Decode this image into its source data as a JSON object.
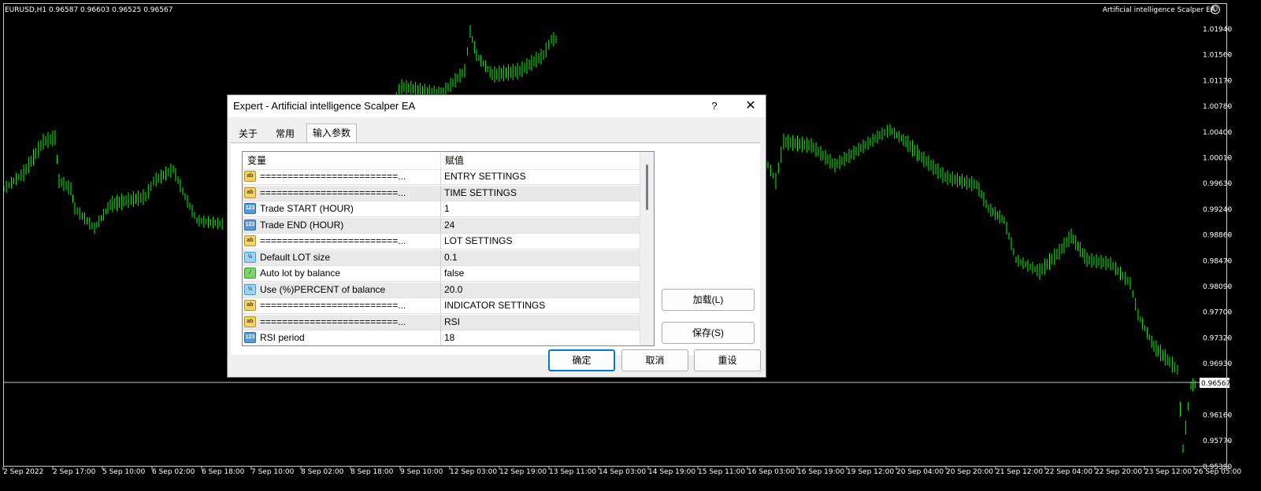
{
  "chart": {
    "symbol_info": "EURUSD,H1  0.96587 0.96603 0.96525 0.96567",
    "ea_name": "Artificial intelligence Scalper EA",
    "current_price": "0.96567",
    "price_levels": [
      "1.01940",
      "1.01560",
      "1.01170",
      "1.00780",
      "1.00400",
      "1.00010",
      "0.99630",
      "0.99240",
      "0.98860",
      "0.98470",
      "0.98090",
      "0.97700",
      "0.97320",
      "0.96930",
      "0.96160",
      "0.95770",
      "0.95390"
    ],
    "time_labels": [
      "2 Sep 2022",
      "2 Sep 17:00",
      "5 Sep 10:00",
      "6 Sep 02:00",
      "6 Sep 18:00",
      "7 Sep 10:00",
      "8 Sep 02:00",
      "8 Sep 18:00",
      "9 Sep 10:00",
      "12 Sep 03:00",
      "12 Sep 19:00",
      "13 Sep 11:00",
      "14 Sep 03:00",
      "14 Sep 19:00",
      "15 Sep 11:00",
      "16 Sep 03:00",
      "16 Sep 19:00",
      "19 Sep 12:00",
      "20 Sep 04:00",
      "20 Sep 20:00",
      "21 Sep 12:00",
      "22 Sep 04:00",
      "22 Sep 20:00",
      "23 Sep 12:00",
      "26 Sep 05:00"
    ],
    "price_line_color": "#c8c8c8",
    "candle_color": "#00ff00",
    "background_color": "#000000"
  },
  "dialog": {
    "title": "Expert - Artificial intelligence Scalper EA",
    "help_label": "?",
    "close_label": "✕",
    "tabs": [
      {
        "label": "关于"
      },
      {
        "label": "常用"
      },
      {
        "label": "输入参数"
      }
    ],
    "active_tab": "输入参数",
    "grid": {
      "col_variable": "变量",
      "col_value": "赋值",
      "rows": [
        {
          "icon": "ab",
          "name": "=========================...",
          "value": "ENTRY SETTINGS"
        },
        {
          "icon": "ab",
          "name": "=========================...",
          "value": "TIME SETTINGS"
        },
        {
          "icon": "123",
          "name": "Trade START (HOUR)",
          "value": "1"
        },
        {
          "icon": "123",
          "name": "Trade END (HOUR)",
          "value": "24"
        },
        {
          "icon": "ab",
          "name": "=========================...",
          "value": "LOT SETTINGS"
        },
        {
          "icon": "½",
          "name": "Default LOT size",
          "value": "0.1"
        },
        {
          "icon": "bool",
          "name": "Auto lot by balance",
          "value": "false"
        },
        {
          "icon": "½",
          "name": "Use (%)PERCENT of balance",
          "value": "20.0"
        },
        {
          "icon": "ab",
          "name": "=========================...",
          "value": "INDICATOR SETTINGS"
        },
        {
          "icon": "ab",
          "name": "=========================...",
          "value": "RSI"
        },
        {
          "icon": "123",
          "name": "RSI period",
          "value": "18"
        }
      ]
    },
    "buttons": {
      "load": "加载(L)",
      "save": "保存(S)",
      "ok": "确定",
      "cancel": "取消",
      "reset": "重设"
    }
  }
}
